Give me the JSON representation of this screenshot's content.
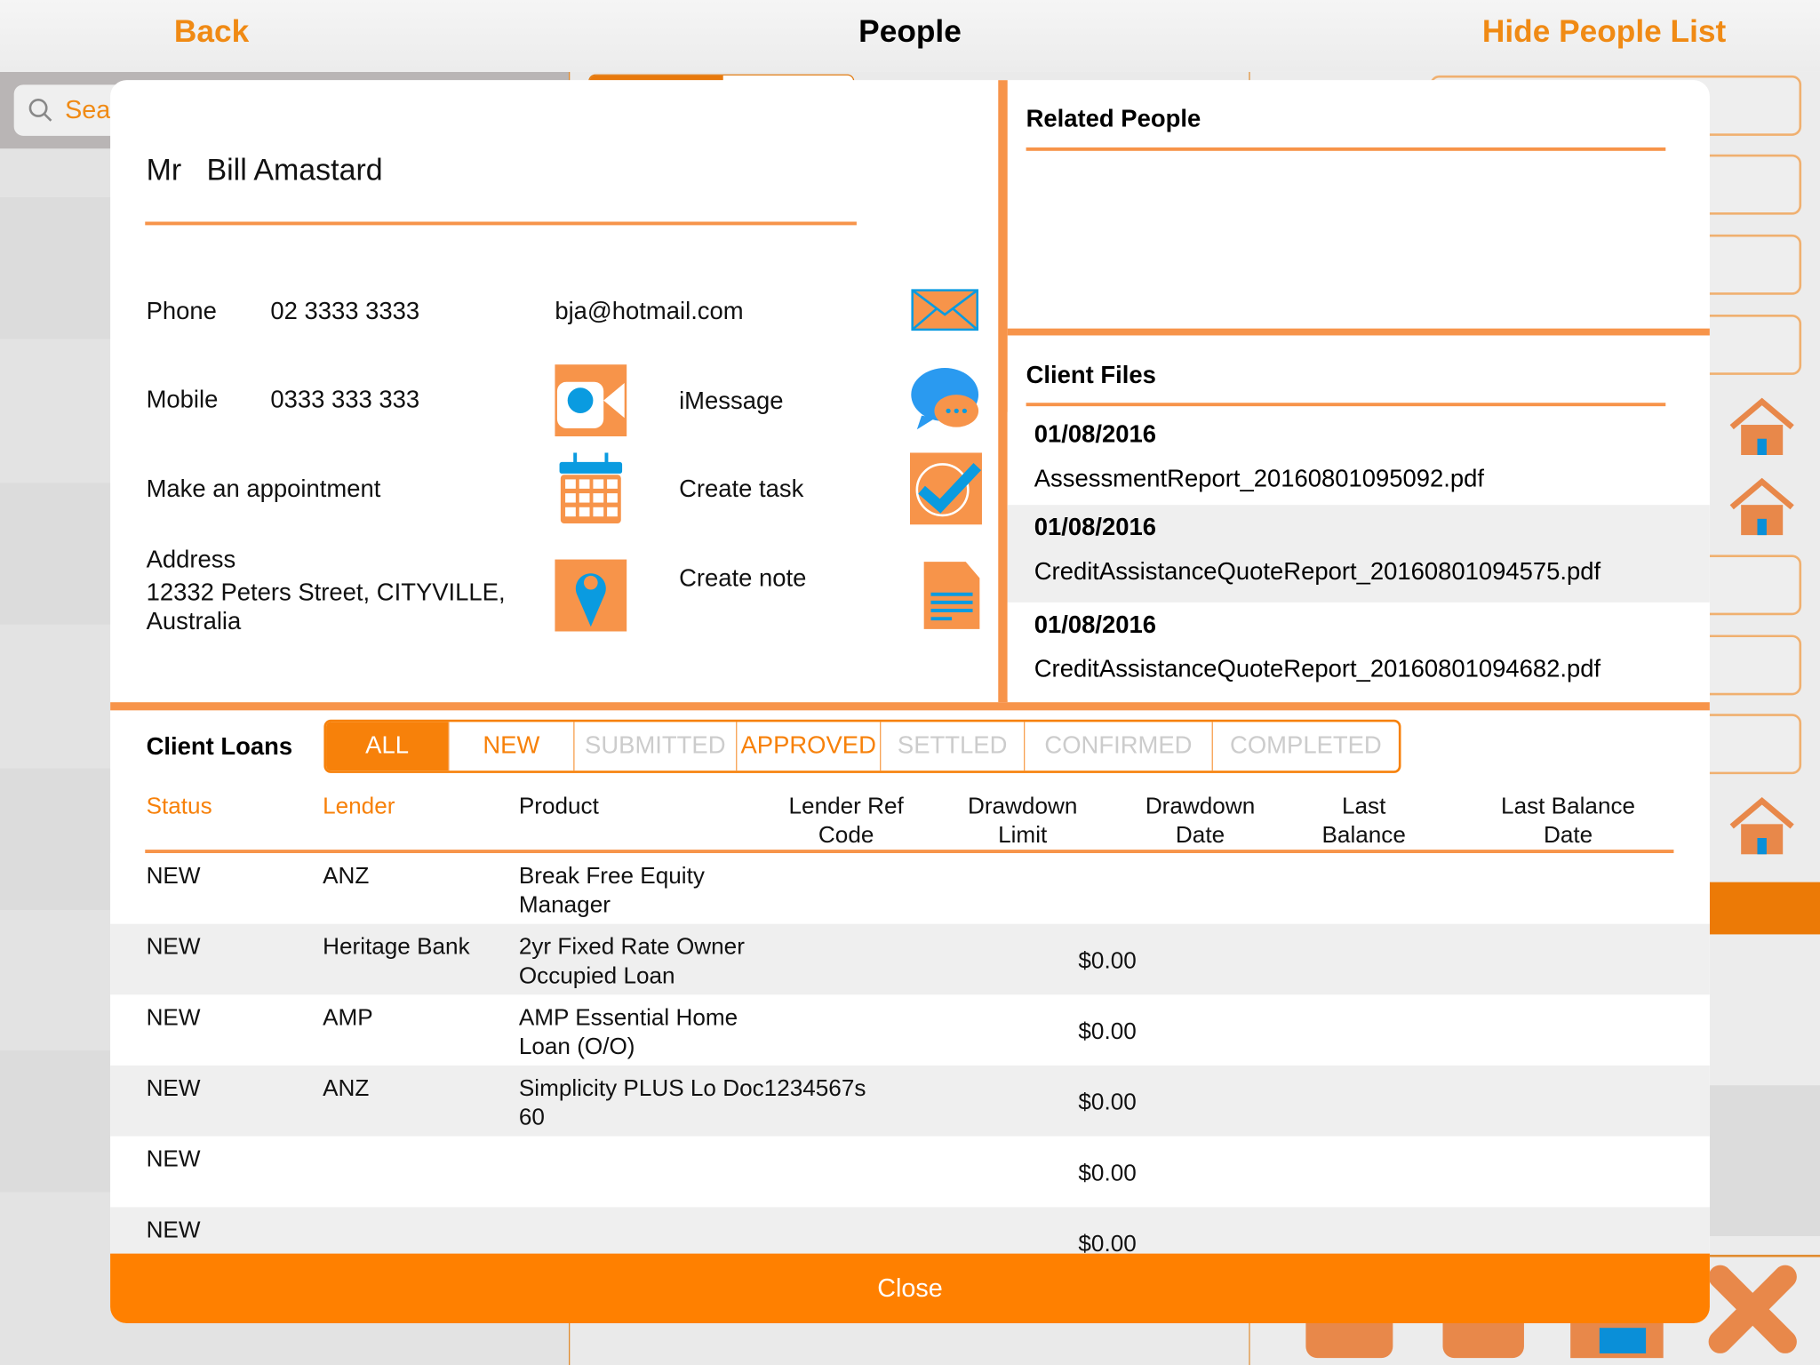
{
  "nav": {
    "back": "Back",
    "title": "People",
    "hide_list": "Hide People List"
  },
  "search": {
    "placeholder": "Search"
  },
  "person": {
    "salutation": "Mr",
    "name": "Bill Amastard"
  },
  "contact": {
    "phone_label": "Phone",
    "phone": "02 3333 3333",
    "email": "bja@hotmail.com",
    "mobile_label": "Mobile",
    "mobile": "0333 333 333",
    "imessage": "iMessage",
    "appointment": "Make an appointment",
    "create_task": "Create task",
    "address_label": "Address",
    "address": "12332 Peters Street, CITYVILLE, Australia",
    "create_note": "Create note"
  },
  "related": {
    "title": "Related People"
  },
  "files": {
    "title": "Client Files",
    "items": [
      {
        "date": "01/08/2016",
        "name": "AssessmentReport_20160801095092.pdf"
      },
      {
        "date": "01/08/2016",
        "name": "CreditAssistanceQuoteReport_20160801094575.pdf"
      },
      {
        "date": "01/08/2016",
        "name": "CreditAssistanceQuoteReport_20160801094682.pdf"
      }
    ]
  },
  "loans": {
    "title": "Client Loans",
    "tabs": [
      "ALL",
      "NEW",
      "SUBMITTED",
      "APPROVED",
      "SETTLED",
      "CONFIRMED",
      "COMPLETED"
    ],
    "active_tab": "ALL",
    "columns": [
      "Status",
      "Lender",
      "Product",
      "Lender Ref\nCode",
      "Drawdown\nLimit",
      "Drawdown\nDate",
      "Last\nBalance",
      "Last Balance\nDate"
    ],
    "rows": [
      {
        "status": "NEW",
        "lender": "ANZ",
        "product": "Break Free Equity\nManager",
        "amount": ""
      },
      {
        "status": "NEW",
        "lender": "Heritage Bank",
        "product": "2yr Fixed Rate Owner\nOccupied Loan",
        "amount": "$0.00"
      },
      {
        "status": "NEW",
        "lender": "AMP",
        "product": "AMP Essential Home\nLoan (O/O)",
        "amount": "$0.00"
      },
      {
        "status": "NEW",
        "lender": "ANZ",
        "product": "Simplicity PLUS Lo Doc1234567s\n60",
        "amount": "$0.00"
      },
      {
        "status": "NEW",
        "lender": "",
        "product": "",
        "amount": "$0.00"
      },
      {
        "status": "NEW",
        "lender": "",
        "product": "",
        "amount": "$0.00"
      }
    ]
  },
  "close": "Close",
  "colors": {
    "accent": "#ff8000",
    "icon_orange": "#f7944a",
    "icon_blue": "#0a9be0"
  }
}
